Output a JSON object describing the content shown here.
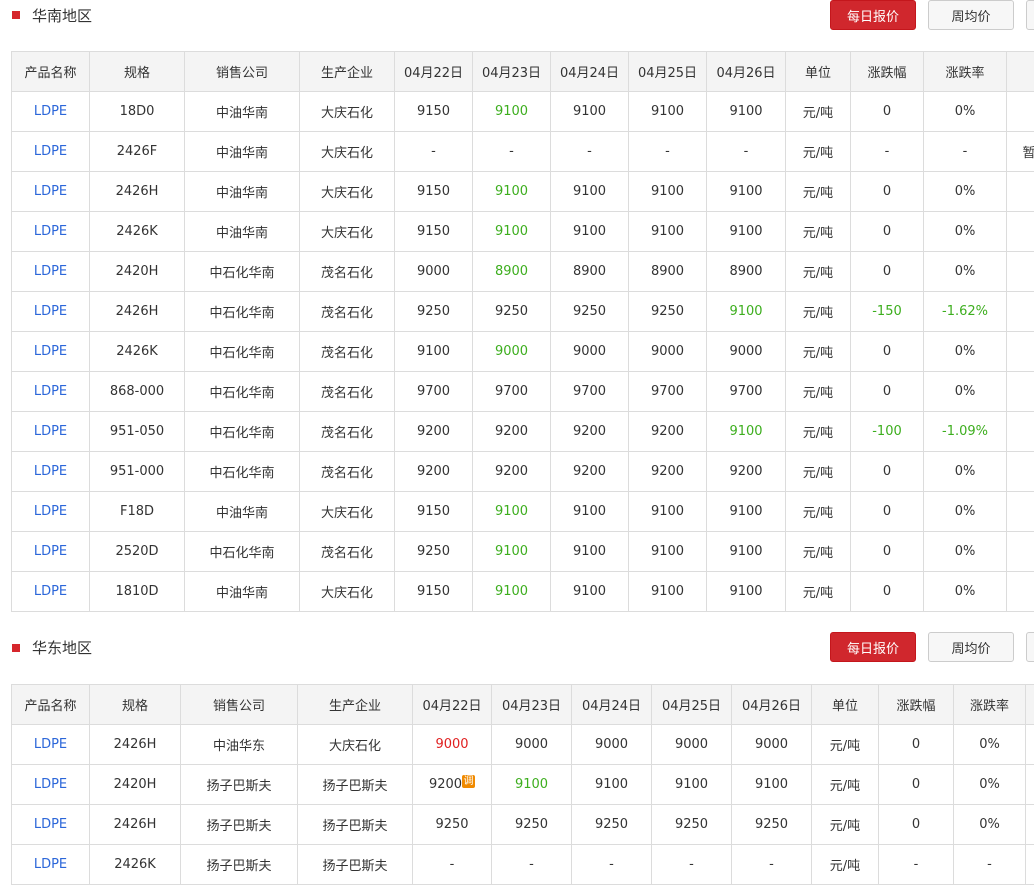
{
  "sections": [
    {
      "title": "华南地区",
      "buttons": {
        "daily": "每日报价",
        "weekly": "周均价"
      },
      "headers": [
        "产品名称",
        "规格",
        "销售公司",
        "生产企业",
        "04月22日",
        "04月23日",
        "04月24日",
        "04月25日",
        "04月26日",
        "单位",
        "涨跌幅",
        "涨跌率",
        ""
      ],
      "rows": [
        {
          "name": "LDPE",
          "spec": "18D0",
          "sales": "中油华南",
          "producer": "大庆石化",
          "p": [
            "9150",
            "9100",
            "9100",
            "9100",
            "9100"
          ],
          "unit": "元/吨",
          "chg": "0",
          "rate": "0%",
          "extra": ""
        },
        {
          "name": "LDPE",
          "spec": "2426F",
          "sales": "中油华南",
          "producer": "大庆石化",
          "p": [
            "-",
            "-",
            "-",
            "-",
            "-"
          ],
          "unit": "元/吨",
          "chg": "-",
          "rate": "-",
          "extra": "暂"
        },
        {
          "name": "LDPE",
          "spec": "2426H",
          "sales": "中油华南",
          "producer": "大庆石化",
          "p": [
            "9150",
            "9100",
            "9100",
            "9100",
            "9100"
          ],
          "unit": "元/吨",
          "chg": "0",
          "rate": "0%",
          "extra": ""
        },
        {
          "name": "LDPE",
          "spec": "2426K",
          "sales": "中油华南",
          "producer": "大庆石化",
          "p": [
            "9150",
            "9100",
            "9100",
            "9100",
            "9100"
          ],
          "unit": "元/吨",
          "chg": "0",
          "rate": "0%",
          "extra": ""
        },
        {
          "name": "LDPE",
          "spec": "2420H",
          "sales": "中石化华南",
          "producer": "茂名石化",
          "p": [
            "9000",
            "8900",
            "8900",
            "8900",
            "8900"
          ],
          "unit": "元/吨",
          "chg": "0",
          "rate": "0%",
          "extra": ""
        },
        {
          "name": "LDPE",
          "spec": "2426H",
          "sales": "中石化华南",
          "producer": "茂名石化",
          "p": [
            "9250",
            "9250",
            "9250",
            "9250",
            "9100"
          ],
          "unit": "元/吨",
          "chg": "-150",
          "rate": "-1.62%",
          "extra": ""
        },
        {
          "name": "LDPE",
          "spec": "2426K",
          "sales": "中石化华南",
          "producer": "茂名石化",
          "p": [
            "9100",
            "9000",
            "9000",
            "9000",
            "9000"
          ],
          "unit": "元/吨",
          "chg": "0",
          "rate": "0%",
          "extra": ""
        },
        {
          "name": "LDPE",
          "spec": "868-000",
          "sales": "中石化华南",
          "producer": "茂名石化",
          "p": [
            "9700",
            "9700",
            "9700",
            "9700",
            "9700"
          ],
          "unit": "元/吨",
          "chg": "0",
          "rate": "0%",
          "extra": ""
        },
        {
          "name": "LDPE",
          "spec": "951-050",
          "sales": "中石化华南",
          "producer": "茂名石化",
          "p": [
            "9200",
            "9200",
            "9200",
            "9200",
            "9100"
          ],
          "unit": "元/吨",
          "chg": "-100",
          "rate": "-1.09%",
          "extra": ""
        },
        {
          "name": "LDPE",
          "spec": "951-000",
          "sales": "中石化华南",
          "producer": "茂名石化",
          "p": [
            "9200",
            "9200",
            "9200",
            "9200",
            "9200"
          ],
          "unit": "元/吨",
          "chg": "0",
          "rate": "0%",
          "extra": ""
        },
        {
          "name": "LDPE",
          "spec": "F18D",
          "sales": "中油华南",
          "producer": "大庆石化",
          "p": [
            "9150",
            "9100",
            "9100",
            "9100",
            "9100"
          ],
          "unit": "元/吨",
          "chg": "0",
          "rate": "0%",
          "extra": ""
        },
        {
          "name": "LDPE",
          "spec": "2520D",
          "sales": "中石化华南",
          "producer": "茂名石化",
          "p": [
            "9250",
            "9100",
            "9100",
            "9100",
            "9100"
          ],
          "unit": "元/吨",
          "chg": "0",
          "rate": "0%",
          "extra": ""
        },
        {
          "name": "LDPE",
          "spec": "1810D",
          "sales": "中油华南",
          "producer": "大庆石化",
          "p": [
            "9150",
            "9100",
            "9100",
            "9100",
            "9100"
          ],
          "unit": "元/吨",
          "chg": "0",
          "rate": "0%",
          "extra": ""
        }
      ],
      "colors": [
        [
          "",
          "g",
          "",
          "",
          ""
        ],
        [
          "",
          "",
          "",
          "",
          ""
        ],
        [
          "",
          "g",
          "",
          "",
          ""
        ],
        [
          "",
          "g",
          "",
          "",
          ""
        ],
        [
          "",
          "g",
          "",
          "",
          ""
        ],
        [
          "",
          "",
          "",
          "",
          "g"
        ],
        [
          "",
          "g",
          "",
          "",
          ""
        ],
        [
          "",
          "",
          "",
          "",
          ""
        ],
        [
          "",
          "",
          "",
          "",
          "g"
        ],
        [
          "",
          "",
          "",
          "",
          ""
        ],
        [
          "",
          "g",
          "",
          "",
          ""
        ],
        [
          "",
          "g",
          "",
          "",
          ""
        ],
        [
          "",
          "g",
          "",
          "",
          ""
        ]
      ]
    },
    {
      "title": "华东地区",
      "buttons": {
        "daily": "每日报价",
        "weekly": "周均价"
      },
      "headers": [
        "产品名称",
        "规格",
        "销售公司",
        "生产企业",
        "04月22日",
        "04月23日",
        "04月24日",
        "04月25日",
        "04月26日",
        "单位",
        "涨跌幅",
        "涨跌率",
        ""
      ],
      "rows": [
        {
          "name": "LDPE",
          "spec": "2426H",
          "sales": "中油华东",
          "producer": "大庆石化",
          "p": [
            "9000",
            "9000",
            "9000",
            "9000",
            "9000"
          ],
          "unit": "元/吨",
          "chg": "0",
          "rate": "0%",
          "extra": ""
        },
        {
          "name": "LDPE",
          "spec": "2420H",
          "sales": "扬子巴斯夫",
          "producer": "扬子巴斯夫",
          "p": [
            "9200",
            "9100",
            "9100",
            "9100",
            "9100"
          ],
          "unit": "元/吨",
          "chg": "0",
          "rate": "0%",
          "extra": "",
          "badge": "调"
        },
        {
          "name": "LDPE",
          "spec": "2426H",
          "sales": "扬子巴斯夫",
          "producer": "扬子巴斯夫",
          "p": [
            "9250",
            "9250",
            "9250",
            "9250",
            "9250"
          ],
          "unit": "元/吨",
          "chg": "0",
          "rate": "0%",
          "extra": ""
        },
        {
          "name": "LDPE",
          "spec": "2426K",
          "sales": "扬子巴斯夫",
          "producer": "扬子巴斯夫",
          "p": [
            "-",
            "-",
            "-",
            "-",
            "-"
          ],
          "unit": "元/吨",
          "chg": "-",
          "rate": "-",
          "extra": ""
        }
      ],
      "colors": [
        [
          "r",
          "",
          "",
          "",
          ""
        ],
        [
          "",
          "g",
          "",
          "",
          ""
        ],
        [
          "",
          "",
          "",
          "",
          ""
        ],
        [
          "",
          "",
          "",
          "",
          ""
        ]
      ]
    }
  ],
  "change_colors": {
    "green": "#3dae1e",
    "red": "#e02020"
  }
}
